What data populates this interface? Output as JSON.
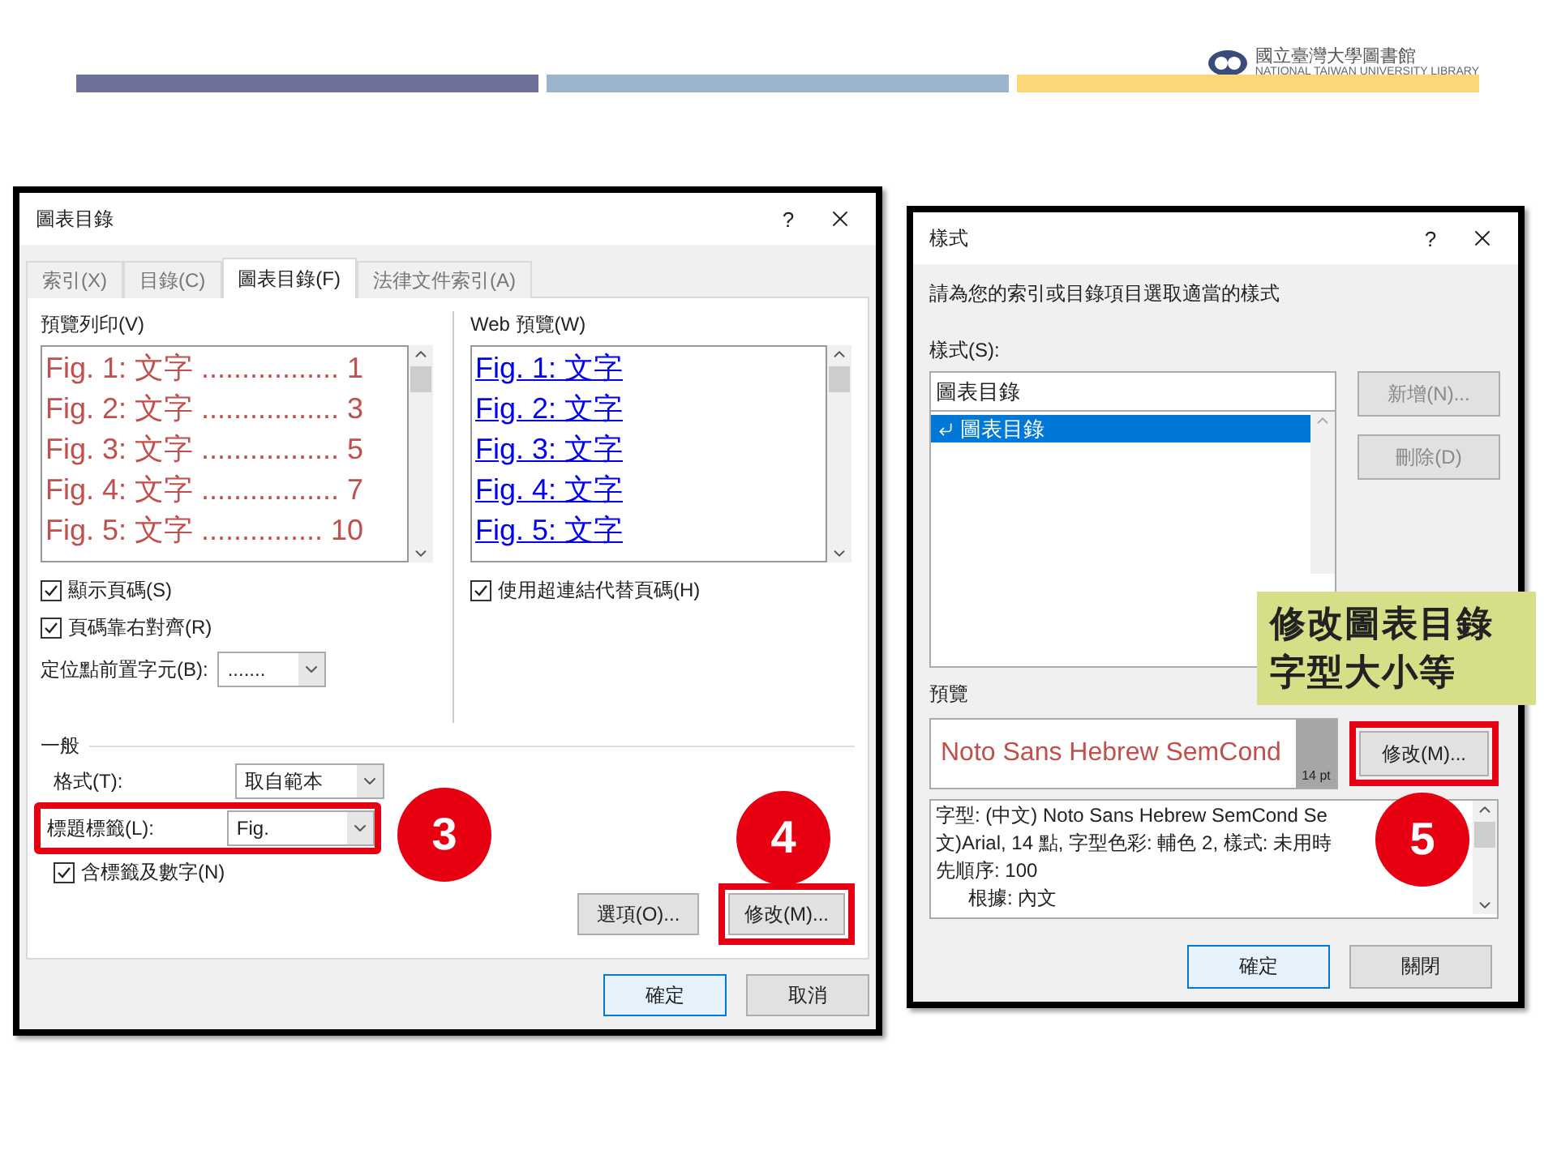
{
  "logo": {
    "name": "國立臺灣大學圖書館",
    "english": "NATIONAL TAIWAN UNIVERSITY LIBRARY"
  },
  "figure_dialog": {
    "title": "圖表目錄",
    "help": "?",
    "tabs": [
      {
        "label": "索引(X)",
        "selected": false
      },
      {
        "label": "目錄(C)",
        "selected": false
      },
      {
        "label": "圖表目錄(F)",
        "selected": true
      },
      {
        "label": "法律文件索引(A)",
        "selected": false
      }
    ],
    "print_preview": {
      "label": "預覽列印(V)",
      "entries": [
        "Fig. 1:  文字 ................. 1",
        "Fig. 2:  文字 ................. 3",
        "Fig. 3:  文字 ................. 5",
        "Fig. 4:  文字 ................. 7",
        "Fig. 5:  文字 ............... 10"
      ]
    },
    "web_preview": {
      "label": "Web 預覽(W)",
      "entries": [
        "Fig. 1:  文字",
        "Fig. 2:  文字",
        "Fig. 3:  文字",
        "Fig. 4:  文字",
        "Fig. 5:  文字"
      ]
    },
    "print_options": [
      {
        "label": "顯示頁碼(S)",
        "checked": true
      },
      {
        "label": "頁碼靠右對齊(R)",
        "checked": true
      }
    ],
    "tab_leader": {
      "label": "定位點前置字元(B):",
      "value": "......."
    },
    "web_option": {
      "label": "使用超連結代替頁碼(H)",
      "checked": true
    },
    "general": {
      "heading": "一般",
      "format": {
        "label": "格式(T):",
        "value": "取自範本"
      },
      "caption_label": {
        "label": "標題標籤(L):",
        "value": "Fig.",
        "highlighted": true
      },
      "include_label": {
        "label": "含標籤及數字(N)",
        "checked": true
      }
    },
    "panel_buttons": [
      {
        "label": "選項(O)...",
        "highlighted": false
      },
      {
        "label": "修改(M)...",
        "highlighted": true
      }
    ],
    "footer_buttons": [
      {
        "label": "確定",
        "default": true
      },
      {
        "label": "取消",
        "default": false
      }
    ]
  },
  "style_dialog": {
    "title": "樣式",
    "help": "?",
    "prompt": "請為您的索引或目錄項目選取適當的樣式",
    "styles_label": "樣式(S):",
    "style_name": "圖表目錄",
    "style_list": [
      {
        "label": "圖表目錄",
        "selected": true
      }
    ],
    "side_buttons": [
      {
        "label": "新增(N)...",
        "disabled": true
      },
      {
        "label": "刪除(D)",
        "disabled": true
      }
    ],
    "preview_label": "預覽",
    "preview_text": "Noto Sans Hebrew SemCond",
    "preview_size": "14 pt",
    "modify_button": {
      "label": "修改(M)...",
      "highlighted": true
    },
    "description": [
      "字型: (中文) Noto Sans Hebrew SemCond Se",
      "文)Arial, 14 點, 字型色彩: 輔色 2, 樣式: 未用時",
      "先順序: 100",
      "根據: 內文"
    ],
    "footer_buttons": [
      {
        "label": "確定",
        "default": true
      },
      {
        "label": "關閉",
        "default": false
      }
    ]
  },
  "steps": [
    "3",
    "4",
    "5"
  ],
  "callout": [
    "修改圖表目錄",
    "字型大小等"
  ]
}
